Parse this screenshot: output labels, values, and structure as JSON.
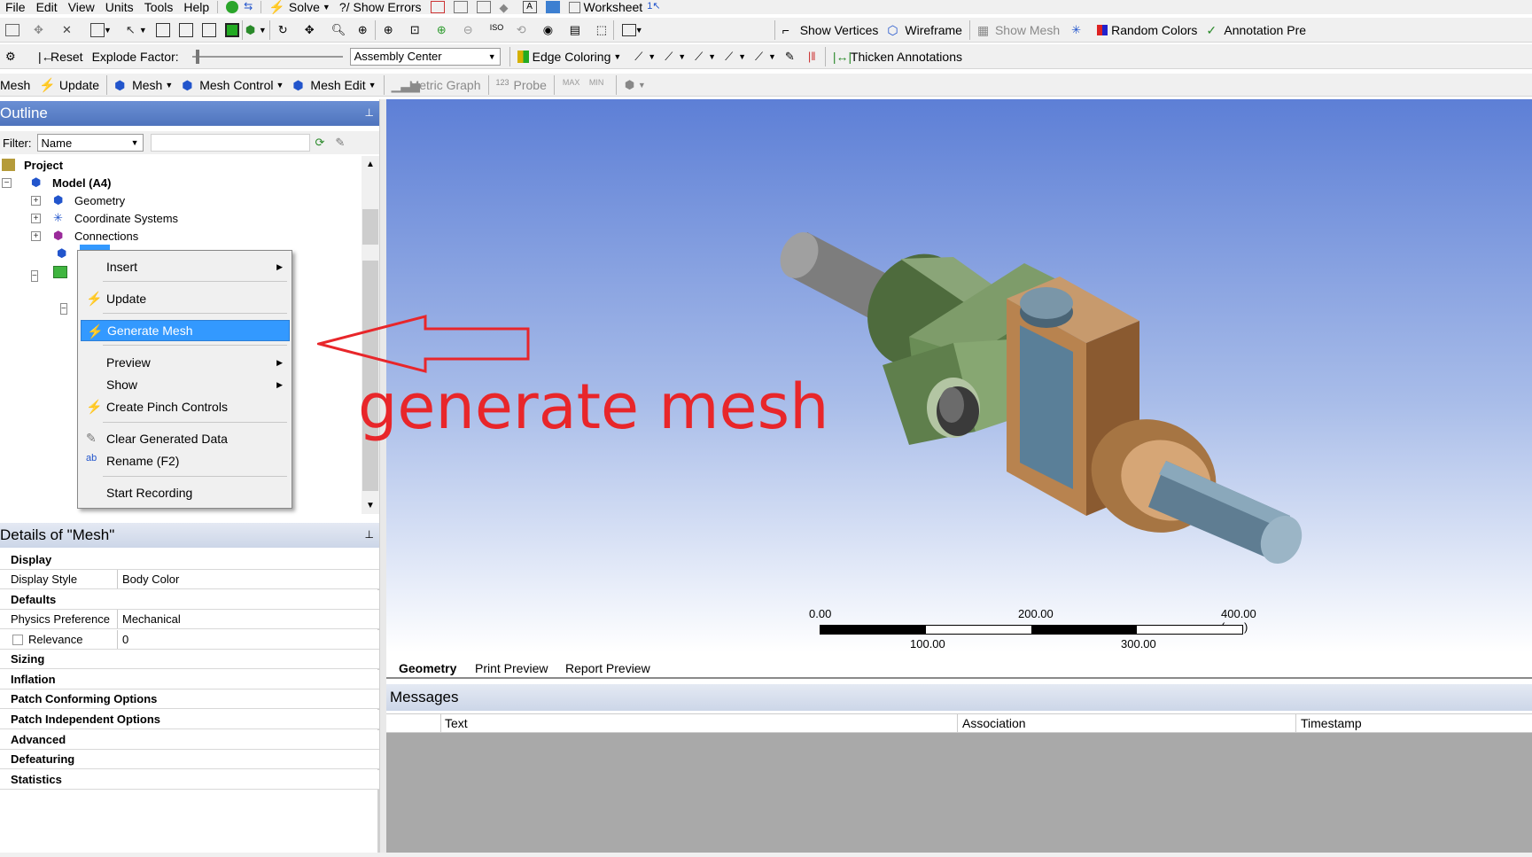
{
  "menubar": {
    "items": [
      "File",
      "Edit",
      "View",
      "Units",
      "Tools",
      "Help"
    ],
    "solve_label": "Solve",
    "show_errors_label": "Show Errors",
    "worksheet_label": "Worksheet"
  },
  "toolbar2": {
    "show_vertices": "Show Vertices",
    "wireframe": "Wireframe",
    "show_mesh": "Show Mesh",
    "random_colors": "Random Colors",
    "annotation_prefs": "Annotation Pre"
  },
  "toolbar3": {
    "reset": "Reset",
    "explode_factor": "Explode Factor:",
    "assembly_select": "Assembly Center",
    "edge_coloring": "Edge Coloring",
    "thicken_annotations": "Thicken Annotations"
  },
  "toolbar4": {
    "mesh": "Mesh",
    "update": "Update",
    "mesh_menu": "Mesh",
    "mesh_control": "Mesh Control",
    "mesh_edit": "Mesh Edit",
    "metric_graph": "Metric Graph",
    "probe": "Probe"
  },
  "outline": {
    "title": "Outline",
    "filter_label": "Filter:",
    "filter_select": "Name",
    "tree": {
      "project": "Project",
      "model": "Model (A4)",
      "geometry": "Geometry",
      "coordinate_systems": "Coordinate Systems",
      "connections": "Connections"
    }
  },
  "context_menu": {
    "insert": "Insert",
    "update": "Update",
    "generate_mesh": "Generate Mesh",
    "preview": "Preview",
    "show": "Show",
    "create_pinch_controls": "Create Pinch Controls",
    "clear_generated_data": "Clear Generated Data",
    "rename": "Rename (F2)",
    "start_recording": "Start Recording"
  },
  "annotation": {
    "text": "generate mesh",
    "color": "#e8262a"
  },
  "details": {
    "title": "Details of \"Mesh\"",
    "rows": {
      "display": "Display",
      "display_style_k": "Display Style",
      "display_style_v": "Body Color",
      "defaults": "Defaults",
      "physics_k": "Physics Preference",
      "physics_v": "Mechanical",
      "relevance_k": "Relevance",
      "relevance_v": "0",
      "sizing": "Sizing",
      "inflation": "Inflation",
      "patch_conforming": "Patch Conforming Options",
      "patch_independent": "Patch Independent Options",
      "advanced": "Advanced",
      "defeaturing": "Defeaturing",
      "statistics": "Statistics"
    }
  },
  "scale": {
    "l0": "0.00",
    "l200": "200.00",
    "l400": "400.00 (mm)",
    "l100": "100.00",
    "l300": "300.00"
  },
  "tabs": [
    "Geometry",
    "Print Preview",
    "Report Preview"
  ],
  "messages": {
    "title": "Messages",
    "columns": [
      "Text",
      "Association",
      "Timestamp"
    ]
  },
  "colors": {
    "viewport_top": "#5d7fd6",
    "viewport_bottom": "#ffffff",
    "panel_title": "#5d7fc9",
    "selection": "#3399ff"
  }
}
